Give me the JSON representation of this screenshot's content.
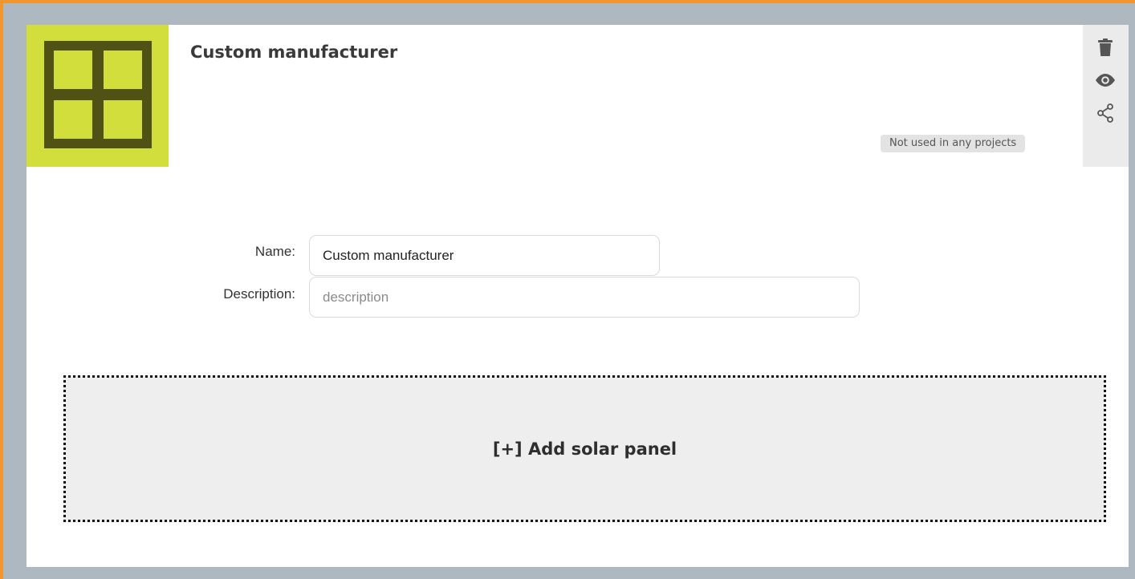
{
  "card": {
    "title": "Custom manufacturer",
    "usage_badge": "Not used in any projects"
  },
  "logo": {
    "icon": "window-grid-icon",
    "background": "#d1de3c",
    "foreground": "#4f5214"
  },
  "actions": [
    {
      "icon": "trash-icon"
    },
    {
      "icon": "eye-icon"
    },
    {
      "icon": "share-icon"
    }
  ],
  "form": {
    "name_label": "Name:",
    "name_value": "Custom manufacturer",
    "description_label": "Description:",
    "description_placeholder": "description",
    "description_value": ""
  },
  "add_panel": {
    "label": "[+] Add solar panel"
  },
  "colors": {
    "accent_border": "#f0962e",
    "frame": "#adb8c1",
    "side_panel": "#ebebeb"
  }
}
